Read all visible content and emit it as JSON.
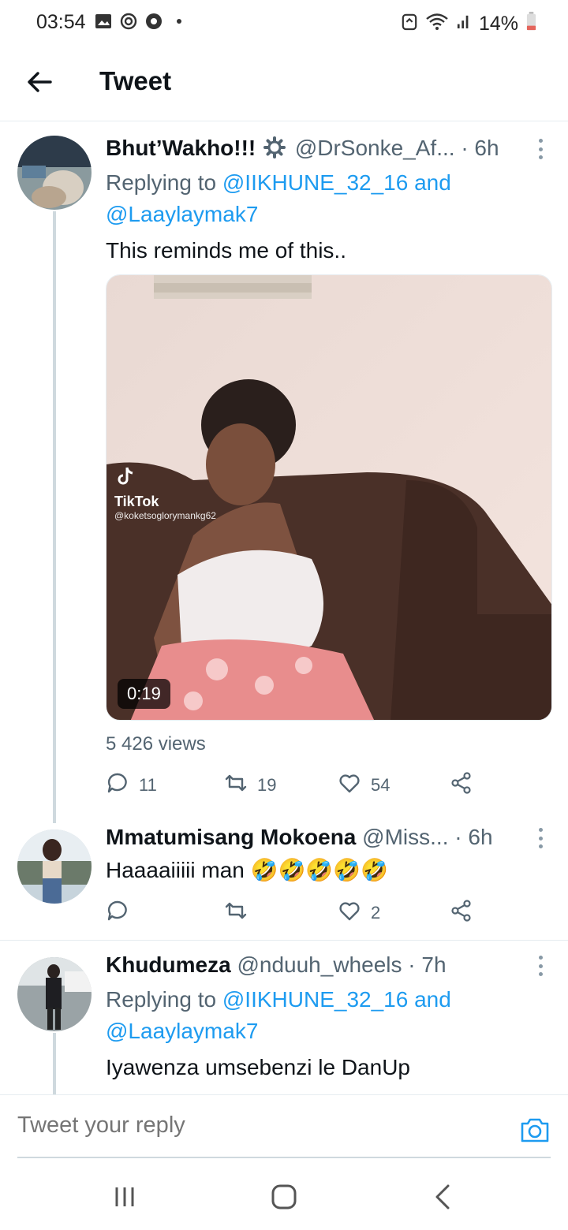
{
  "status_bar": {
    "time": "03:54",
    "battery": "14%",
    "icons_left": [
      "gallery-icon",
      "sync-icon",
      "chrome-icon",
      "notification-dot"
    ],
    "icons_right": [
      "alarm-icon",
      "wifi-icon",
      "signal-icon",
      "battery-icon"
    ]
  },
  "header": {
    "title": "Tweet",
    "back_icon": "back-arrow-icon"
  },
  "tweets": [
    {
      "name": "Bhut’Wakho!!!",
      "badge_icon": "gear-icon",
      "handle": "@DrSonke_Af...",
      "time": "· 6h",
      "replying_prefix": "Replying to ",
      "replying_to_1": "@IIKHUNE_32_16",
      "replying_and": " and",
      "replying_to_2": "@Laaylaymak7",
      "text": "This reminds me of this..",
      "media": {
        "duration": "0:19",
        "watermark": "TikTok",
        "watermark_user": "@koketsoglorymankg62"
      },
      "views": "5 426 views",
      "replies": "11",
      "retweets": "19",
      "likes": "54"
    },
    {
      "name": "Mmatumisang Mokoena",
      "handle": "@Miss...",
      "time": "· 6h",
      "text": "Haaaaiiiii man 🤣🤣🤣🤣🤣",
      "replies": "",
      "retweets": "",
      "likes": "2"
    },
    {
      "name": "Khudumeza",
      "handle": "@nduuh_wheels",
      "time": "· 7h",
      "replying_prefix": "Replying to ",
      "replying_to_1": "@IIKHUNE_32_16",
      "replying_and": " and",
      "replying_to_2": "@Laaylaymak7",
      "text": "Iyawenza umsebenzi le DanUp"
    }
  ],
  "reply_bar": {
    "placeholder": "Tweet your reply",
    "camera_icon": "camera-icon"
  },
  "nav_bar": [
    "recents-icon",
    "home-icon",
    "back-icon"
  ],
  "colors": {
    "accent": "#1d9bf0",
    "text": "#0f1419",
    "secondary": "#536471",
    "divider": "#e6ecf0"
  }
}
